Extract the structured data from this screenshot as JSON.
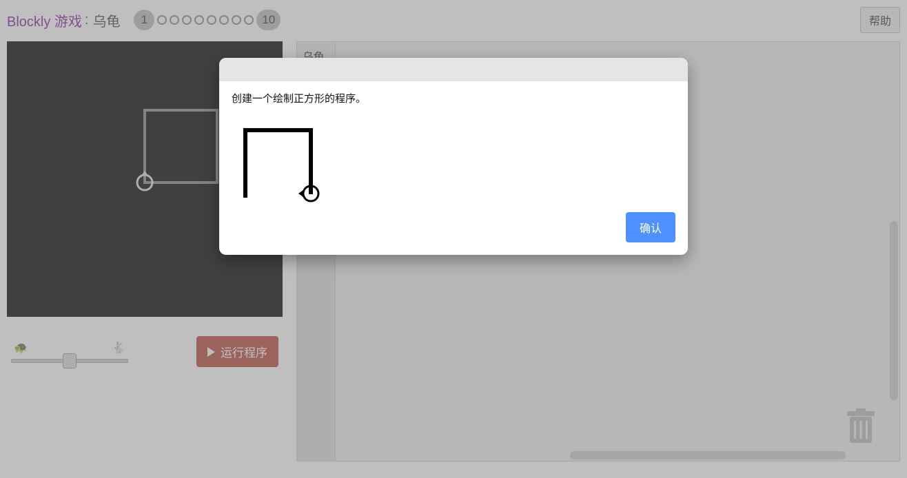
{
  "header": {
    "brand": "Blockly 游戏",
    "separator": ":",
    "title": "乌龟",
    "current_level": "1",
    "last_level": "10",
    "help_label": "帮助"
  },
  "toolbox": {
    "tab_label": "乌龟"
  },
  "controls": {
    "run_label": "运行程序",
    "slow_icon": "🐢",
    "fast_icon": "🐇"
  },
  "dialog": {
    "message": "创建一个绘制正方形的程序。",
    "ok_label": "确认"
  }
}
